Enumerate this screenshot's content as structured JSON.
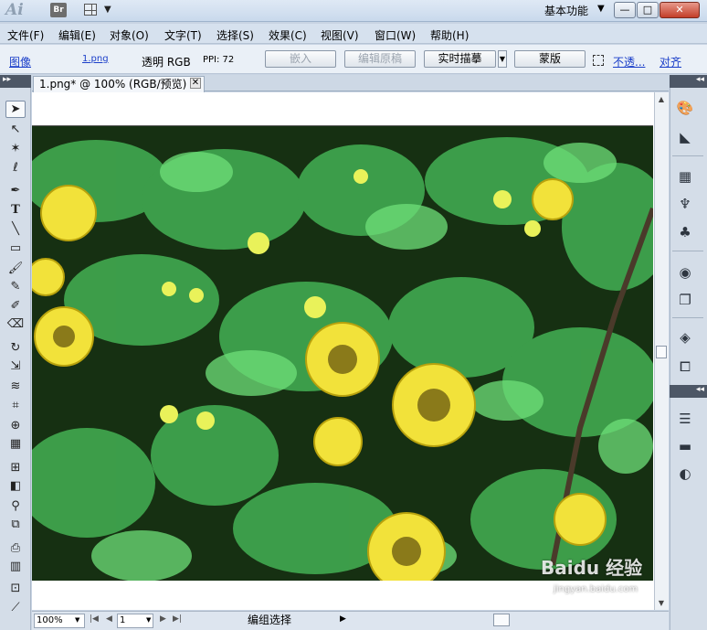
{
  "titlebar": {
    "app_logo": "Ai",
    "bridge_label": "Br",
    "workspace_label": "基本功能",
    "workspace_dropdown": "▼",
    "minimize": "—",
    "maximize": "□",
    "close": "✕"
  },
  "menu": {
    "items": [
      "文件(F)",
      "编辑(E)",
      "对象(O)",
      "文字(T)",
      "选择(S)",
      "效果(C)",
      "视图(V)",
      "窗口(W)",
      "帮助(H)"
    ]
  },
  "control_bar": {
    "object_type": "图像",
    "file_name": "1.png",
    "color_mode": "透明 RGB",
    "ppi": "PPI: 72",
    "embed_button": "嵌入",
    "edit_original_button": "编辑原稿",
    "live_trace_button": "实时描摹",
    "mask_button": "蒙版",
    "opacity_link": "不透...",
    "align_link": "对齐"
  },
  "document": {
    "tab_title": "1.png* @ 100% (RGB/预览)",
    "tab_close": "✕"
  },
  "status": {
    "zoom": "100%",
    "page": "1",
    "status_text": "编组选择"
  },
  "tools": [
    "selection-tool",
    "direct-selection-tool",
    "magic-wand-tool",
    "lasso-tool",
    "pen-tool",
    "type-tool",
    "line-tool",
    "rectangle-tool",
    "paintbrush-tool",
    "pencil-tool",
    "blob-brush-tool",
    "eraser-tool",
    "rotate-tool",
    "scale-tool",
    "warp-tool",
    "free-transform-tool",
    "shape-builder-tool",
    "perspective-grid-tool",
    "mesh-tool",
    "gradient-tool",
    "eyedropper-tool",
    "blend-tool",
    "symbol-sprayer-tool",
    "column-graph-tool",
    "artboard-tool",
    "slice-tool"
  ],
  "dock_icons": [
    "color-icon",
    "color-guide-icon",
    "swatches-icon",
    "brushes-icon",
    "symbols-icon",
    "appearance-icon",
    "graphic-styles-icon",
    "layers-icon",
    "artboards-icon",
    "stroke-icon",
    "gradient-icon",
    "transparency-icon"
  ],
  "watermark": {
    "logo": "Baidu 经验",
    "sub": "jingyan.baidu.com"
  },
  "colors": {
    "accent_link": "#1a3ec9",
    "panel_dark": "#4d5766",
    "close_red": "#c33e29"
  }
}
